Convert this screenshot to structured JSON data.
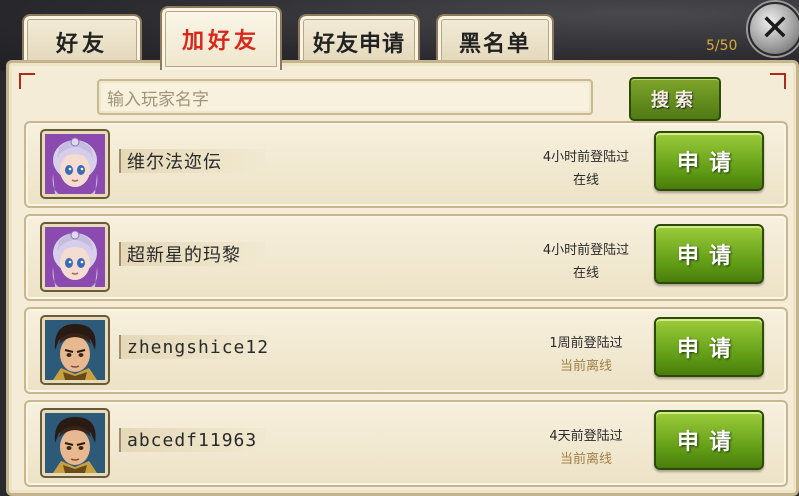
{
  "tabs": [
    {
      "label": "好友",
      "active": false
    },
    {
      "label": "加好友",
      "active": true
    },
    {
      "label": "好友申请",
      "active": false
    },
    {
      "label": "黑名单",
      "active": false
    }
  ],
  "friend_count": "5/50",
  "close_icon": "close-x-icon",
  "search": {
    "placeholder": "输入玩家名字",
    "button_label": "搜索"
  },
  "players": [
    {
      "name": "维尔法迩伝",
      "last_login": "4小时前登陆过",
      "status": "在线",
      "online": true,
      "avatar": "female-mage-avatar",
      "apply_label": "申请"
    },
    {
      "name": "超新星的玛黎",
      "last_login": "4小时前登陆过",
      "status": "在线",
      "online": true,
      "avatar": "female-mage-avatar",
      "apply_label": "申请"
    },
    {
      "name": "zhengshice12",
      "last_login": "1周前登陆过",
      "status": "当前离线",
      "online": false,
      "avatar": "male-warrior-avatar",
      "apply_label": "申请"
    },
    {
      "name": "abcedf11963",
      "last_login": "4天前登陆过",
      "status": "当前离线",
      "online": false,
      "avatar": "male-warrior-avatar",
      "apply_label": "申请"
    }
  ],
  "colors": {
    "active_tab_text": "#d8281a",
    "button_green": "#5e9a14",
    "offline_text": "#a08048",
    "count_text": "#d9a93a"
  }
}
